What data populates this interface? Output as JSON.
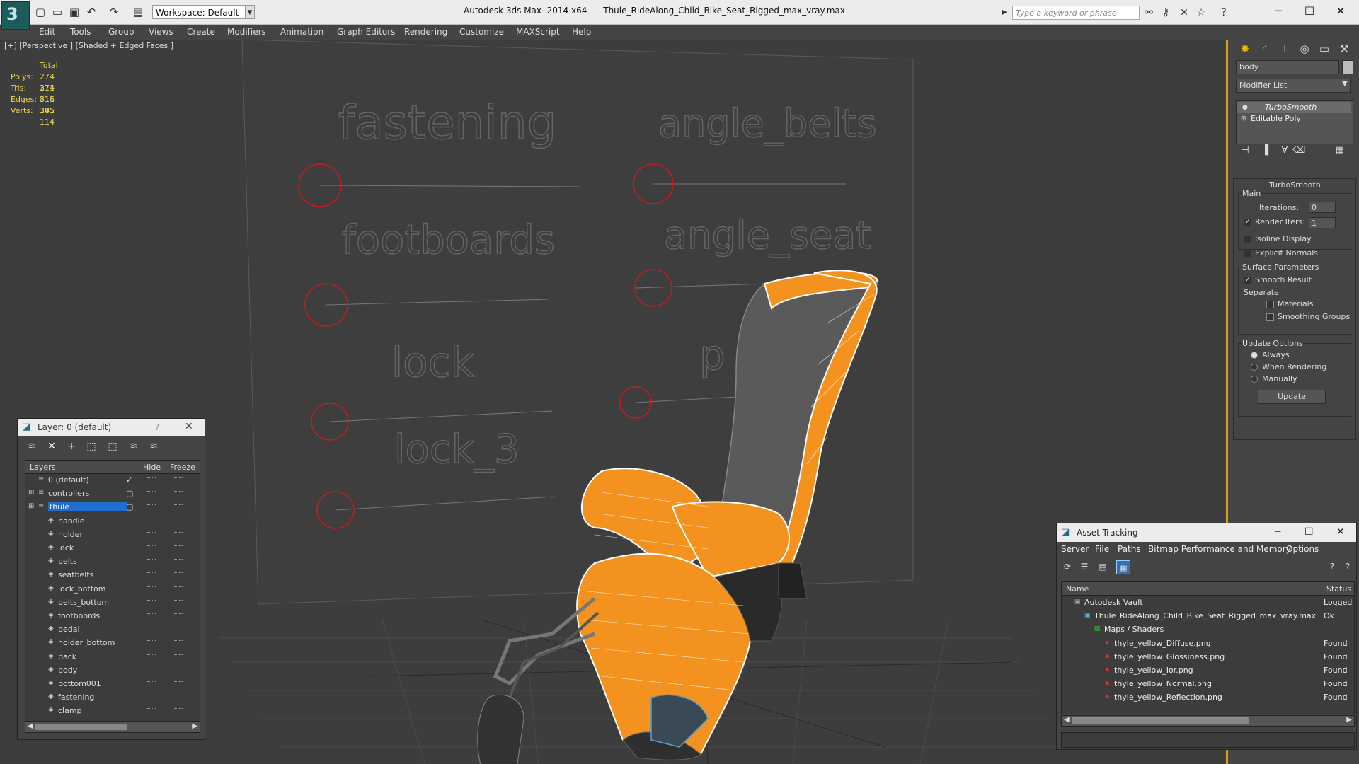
{
  "app": {
    "logo": "3",
    "workspace": "Workspace: Default",
    "title": "Autodesk 3ds Max  2014 x64      Thule_RideAlong_Child_Bike_Seat_Rigged_max_vray.max",
    "search_placeholder": "Type a keyword or phrase"
  },
  "menu": [
    "Edit",
    "Tools",
    "Group",
    "Views",
    "Create",
    "Modifiers",
    "Animation",
    "Graph Editors",
    "Rendering",
    "Customize",
    "MAXScript",
    "Help"
  ],
  "viewport": {
    "label": "[+] [Perspective ] [Shaded + Edged Faces ]",
    "stats": {
      "header": "Total",
      "rows": [
        {
          "label": "Polys:",
          "value": "274 311"
        },
        {
          "label": "Tris:",
          "value": "274 311"
        },
        {
          "label": "Edges:",
          "value": "816 385"
        },
        {
          "label": "Verts:",
          "value": "141 114"
        }
      ]
    },
    "rig_labels": [
      "fastening",
      "angle_belts",
      "footboards",
      "angle_seat",
      "lock",
      "p",
      "lock_3"
    ],
    "colors": {
      "seat": "#f3921e",
      "wire": "#ffffff",
      "control": "#cc1a1a"
    }
  },
  "command_panel": {
    "object_name": "body",
    "modifier_list": "Modifier List",
    "stack": [
      "TurboSmooth",
      "Editable Poly"
    ],
    "rollout_title": "TurboSmooth",
    "main_label": "Main",
    "iterations_label": "Iterations:",
    "iterations_value": "0",
    "render_iters_label": "Render Iters:",
    "render_iters_value": "1",
    "isoline_display": "Isoline Display",
    "explicit_normals": "Explicit Normals",
    "surface_params": "Surface Parameters",
    "smooth_result": "Smooth Result",
    "separate": "Separate",
    "materials": "Materials",
    "smoothing_groups": "Smoothing Groups",
    "update_options": "Update Options",
    "always": "Always",
    "when_rendering": "When Rendering",
    "manually": "Manually",
    "update_btn": "Update"
  },
  "layer_window": {
    "title": "Layer: 0 (default)",
    "help": "?",
    "col_layers": "Layers",
    "col_hide": "Hide",
    "col_freeze": "Freeze",
    "layers": [
      {
        "name": "0 (default)"
      },
      {
        "name": "controllers"
      },
      {
        "name": "thule"
      }
    ],
    "objects": [
      "handle",
      "holder",
      "lock",
      "belts",
      "seatbelts",
      "lock_bottom",
      "belts_bottom",
      "footboords",
      "pedal",
      "holder_bottom",
      "back",
      "body",
      "bottom001",
      "fastening",
      "clamp"
    ]
  },
  "asset_window": {
    "title": "Asset Tracking",
    "menu": [
      "Server",
      "File",
      "Paths",
      "Bitmap Performance and Memory",
      "Options"
    ],
    "col_name": "Name",
    "col_status": "Status",
    "rows": [
      {
        "name": "Autodesk Vault",
        "status": "Logged O"
      },
      {
        "name": "Thule_RideAlong_Child_Bike_Seat_Rigged_max_vray.max",
        "status": "Ok"
      },
      {
        "name": "Maps / Shaders",
        "status": ""
      },
      {
        "name": "thyle_yellow_Diffuse.png",
        "status": "Found"
      },
      {
        "name": "thyle_yellow_Glossiness.png",
        "status": "Found"
      },
      {
        "name": "thyle_yellow_Ior.png",
        "status": "Found"
      },
      {
        "name": "thyle_yellow_Normal.png",
        "status": "Found"
      },
      {
        "name": "thyle_yellow_Reflection.png",
        "status": "Found"
      }
    ]
  }
}
